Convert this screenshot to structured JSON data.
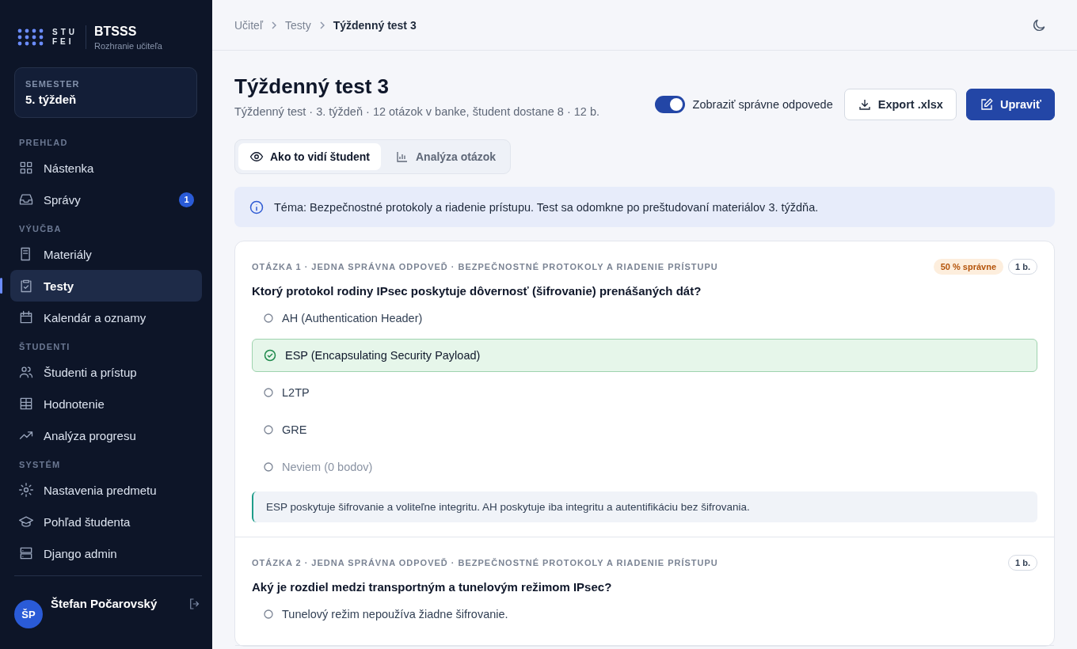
{
  "sidebar": {
    "logo": {
      "top": "STU",
      "bottom": "FEI"
    },
    "app_name": "BTSSS",
    "app_subtitle": "Rozhranie učiteľa",
    "semester": {
      "label": "SEMESTER",
      "value": "5. týždeň"
    },
    "sections": [
      {
        "title": "PREHĽAD",
        "items": [
          {
            "label": "Nástenka",
            "selected": false
          },
          {
            "label": "Správy",
            "selected": false,
            "badge": "1"
          }
        ]
      },
      {
        "title": "VÝUČBA",
        "items": [
          {
            "label": "Materiály",
            "selected": false
          },
          {
            "label": "Testy",
            "selected": true
          },
          {
            "label": "Kalendár a oznamy",
            "selected": false
          }
        ]
      },
      {
        "title": "ŠTUDENTI",
        "items": [
          {
            "label": "Študenti a prístup",
            "selected": false
          },
          {
            "label": "Hodnotenie",
            "selected": false
          },
          {
            "label": "Analýza progresu",
            "selected": false
          }
        ]
      },
      {
        "title": "SYSTÉM",
        "items": [
          {
            "label": "Nastavenia predmetu",
            "selected": false
          },
          {
            "label": "Pohľad študenta",
            "selected": false
          },
          {
            "label": "Django admin",
            "selected": false
          }
        ]
      }
    ],
    "user": {
      "initials": "ŠP",
      "name": "Štefan Počarovský"
    }
  },
  "breadcrumbs": [
    {
      "label": "Učiteľ",
      "current": false
    },
    {
      "label": "Testy",
      "current": false
    },
    {
      "label": "Týždenný test 3",
      "current": true
    }
  ],
  "header": {
    "title": "Týždenný test 3",
    "subtitle": "Týždenný test · 3. týždeň · 12 otázok v banke, študent dostane 8 · 12 b.",
    "toggle": {
      "label": "Zobraziť správne odpovede",
      "on": true
    },
    "buttons": [
      {
        "label": "Export .xlsx",
        "kind": "secondary"
      },
      {
        "label": "Upraviť",
        "kind": "primary"
      }
    ]
  },
  "tabs": [
    {
      "label": "Ako to vidí študent",
      "selected": true
    },
    {
      "label": "Analýza otázok",
      "selected": false
    }
  ],
  "info": "Téma: Bezpečnostné protokoly a riadenie prístupu. Test sa odomkne po preštudovaní materiálov 3. týždňa.",
  "questions": [
    {
      "meta": "OTÁZKA 1 · JEDNA SPRÁVNA ODPOVEĎ · BEZPEČNOSTNÉ PROTOKOLY A RIADENIE PRÍSTUPU",
      "success_rate": "50 % správne",
      "points": "1 b.",
      "text": "Ktorý protokol rodiny IPsec poskytuje dôvernosť (šifrovanie) prenášaných dát?",
      "options": [
        {
          "label": "AH (Authentication Header)",
          "correct": false,
          "dimmed": false
        },
        {
          "label": "ESP (Encapsulating Security Payload)",
          "correct": true,
          "dimmed": false
        },
        {
          "label": "L2TP",
          "correct": false,
          "dimmed": false
        },
        {
          "label": "GRE",
          "correct": false,
          "dimmed": false
        },
        {
          "label": "Neviem (0 bodov)",
          "correct": false,
          "dimmed": true
        }
      ],
      "explanation": "ESP poskytuje šifrovanie a voliteľne integritu. AH poskytuje iba integritu a autentifikáciu bez šifrovania."
    },
    {
      "meta": "OTÁZKA 2 · JEDNA SPRÁVNA ODPOVEĎ · BEZPEČNOSTNÉ PROTOKOLY A RIADENIE PRÍSTUPU",
      "points": "1 b.",
      "text": "Aký je rozdiel medzi transportným a tunelovým režimom IPsec?",
      "options": [
        {
          "label": "Tunelový režim nepoužíva žiadne šifrovanie.",
          "correct": false,
          "dimmed": false
        }
      ]
    }
  ]
}
